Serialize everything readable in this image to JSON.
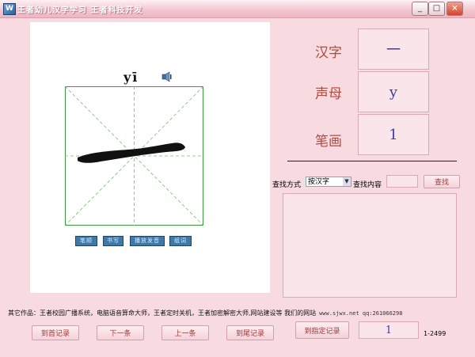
{
  "window": {
    "title": "王者幼儿汉字学习  王者科技开发",
    "icon_text": "W",
    "minimize": "_",
    "maximize": "□",
    "close": "×"
  },
  "display": {
    "pinyin": "yī",
    "buttons": [
      "笔顺",
      "书写",
      "播放发音",
      "组词"
    ]
  },
  "info": {
    "hanzi_label": "汉字",
    "hanzi_value": "一",
    "shengmu_label": "声母",
    "shengmu_value": "y",
    "bihua_label": "笔画",
    "bihua_value": "1"
  },
  "search": {
    "mode_label": "查找方式",
    "mode_value": "按汉字",
    "content_label": "查找内容",
    "content_value": "",
    "find_button": "查找"
  },
  "footer": {
    "text": "其它作品：王者校园广播系统，电脑语音算命大师，王者定时关机，王者加密解密大师,网站建设等 我们的网站",
    "url": "www.sjwx.net qq:261066298"
  },
  "nav": {
    "first": "到首记录",
    "next": "下一条",
    "prev": "上一条",
    "last": "到尾记录",
    "goto": "到指定记录",
    "record_value": "1",
    "range": "1-2499"
  },
  "colors": {
    "background": "#f8dbe1",
    "label": "#b24a3f",
    "value": "#3d3ba8"
  }
}
